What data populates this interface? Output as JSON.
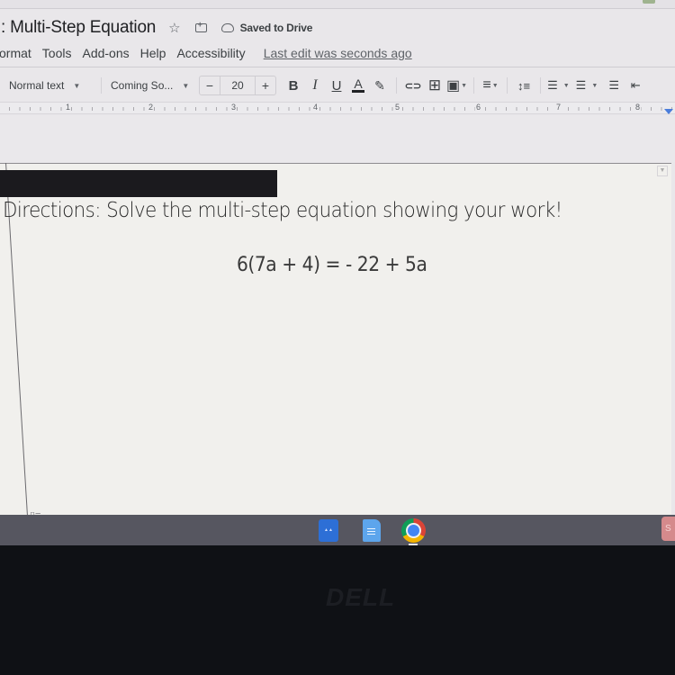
{
  "document": {
    "title": ": Multi-Step Equation",
    "save_status": "Saved to Drive",
    "star_icon": "star-icon",
    "move_icon": "folder-move-icon",
    "cloud_icon": "cloud-check-icon"
  },
  "menu": {
    "items": [
      "ormat",
      "Tools",
      "Add-ons",
      "Help",
      "Accessibility"
    ],
    "last_edit": "Last edit was seconds ago"
  },
  "toolbar": {
    "style_select": "Normal text",
    "font_select": "Coming So...",
    "font_size_decrease": "−",
    "font_size": "20",
    "font_size_increase": "+",
    "bold": "B",
    "italic": "I",
    "underline": "U",
    "text_color": "A",
    "highlight_glyph": "✎",
    "link_glyph": "⊂⊃",
    "comment_glyph": "⊞",
    "image_glyph": "▣",
    "align_glyph": "≡",
    "line_spacing_glyph": "↕≡",
    "checklist_glyph": "☰",
    "bullet_glyph": "☰",
    "numbered_glyph": "☰",
    "indent_glyph": "⇤"
  },
  "ruler": {
    "numbers": [
      "1",
      "2",
      "3",
      "4",
      "5",
      "6",
      "7",
      "8"
    ]
  },
  "page": {
    "directions": "Directions:  Solve the multi-step equation showing your work!",
    "equation": "6(7a + 4) = - 22 + 5a",
    "outline_glyph": "▯≡"
  },
  "shelf": {
    "apps": [
      "data-studio-app",
      "google-docs-app",
      "chrome-app"
    ],
    "status_glyph": "S"
  },
  "bezel": {
    "brand": "DELL"
  },
  "colors": {
    "accent_blue": "#4a7ddb",
    "shelf": "#565660",
    "page": "#f1f0ed"
  }
}
